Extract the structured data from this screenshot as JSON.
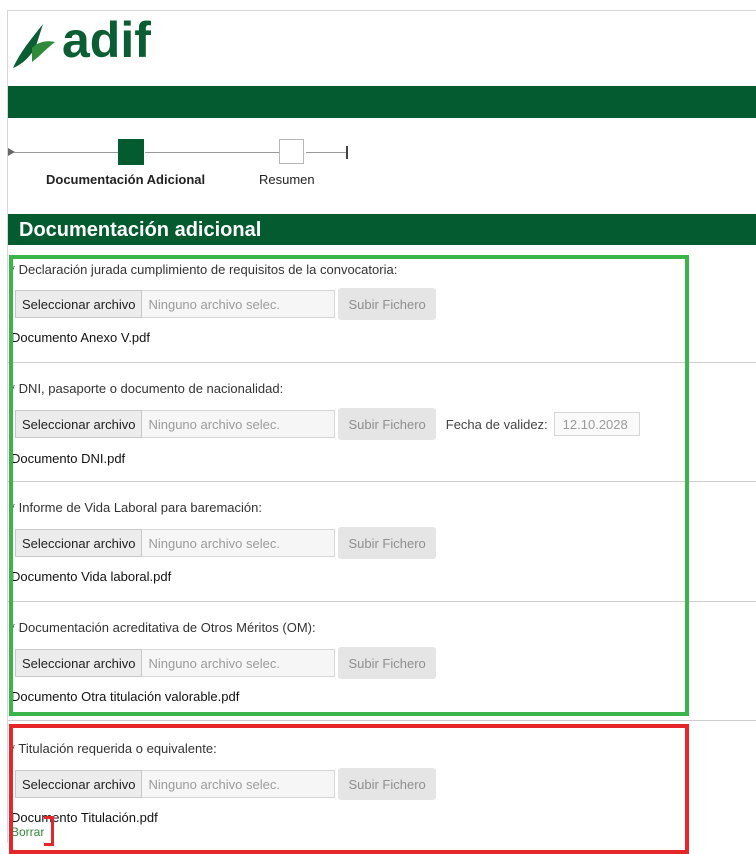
{
  "brand": {
    "name": "adif",
    "color": "#045b2f",
    "logo_icon": "adif-leaf-logo"
  },
  "stepper": {
    "steps": [
      {
        "label": "Documentación Adicional",
        "state": "active"
      },
      {
        "label": "Resumen",
        "state": "pending"
      }
    ]
  },
  "section": {
    "title": "Documentación adicional"
  },
  "common": {
    "select_file_label": "Seleccionar archivo",
    "no_file_placeholder": "Ninguno archivo selec.",
    "upload_label": "Subir Fichero"
  },
  "documents": [
    {
      "label": "* Declaración jurada cumplimiento de requisitos de la convocatoria:",
      "file": "Documento Anexo V.pdf"
    },
    {
      "label": "* DNI, pasaporte o documento de nacionalidad:",
      "file": "Documento DNI.pdf",
      "validity_label": "Fecha de validez:",
      "validity_value": "12.10.2028"
    },
    {
      "label": "* Informe de Vida Laboral para baremación:",
      "file": "Documento Vida laboral.pdf"
    },
    {
      "label": "* Documentación acreditativa de Otros Méritos (OM):",
      "file": "Documento Otra titulación valorable.pdf"
    },
    {
      "label": "* Titulación requerida o equivalente:",
      "file": "Documento Titulación.pdf",
      "delete_label": "Borrar"
    }
  ],
  "highlight_colors": {
    "green": "#3ab54a",
    "red": "#e5262b"
  }
}
